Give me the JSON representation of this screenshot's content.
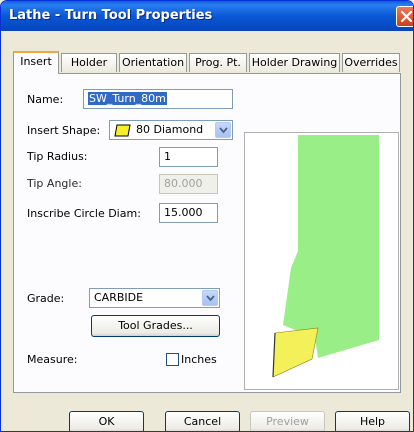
{
  "window": {
    "title": "Lathe - Turn Tool Properties"
  },
  "tabs": [
    {
      "label": "Insert",
      "active": true
    },
    {
      "label": "Holder"
    },
    {
      "label": "Orientation"
    },
    {
      "label": "Prog. Pt."
    },
    {
      "label": "Holder Drawing"
    },
    {
      "label": "Overrides"
    }
  ],
  "insert": {
    "name_label": "Name:",
    "name_value": "SW_Turn_80m",
    "shape_label": "Insert Shape:",
    "shape_value": "80 Diamond",
    "tip_radius_label": "Tip Radius:",
    "tip_radius_value": "1",
    "tip_angle_label": "Tip Angle:",
    "tip_angle_value": "80.000",
    "inscribe_label": "Inscribe Circle Diam:",
    "inscribe_value": "15.000",
    "grade_label": "Grade:",
    "grade_value": "CARBIDE",
    "tool_grades_button": "Tool Grades...",
    "measure_label": "Measure:",
    "inches_label": "Inches",
    "inches_checked": false
  },
  "drawing": {
    "holder_color": "#99ee88",
    "insert_color": "#f4f05a"
  },
  "buttons": {
    "ok": "OK",
    "cancel": "Cancel",
    "preview": "Preview",
    "help": "Help"
  }
}
